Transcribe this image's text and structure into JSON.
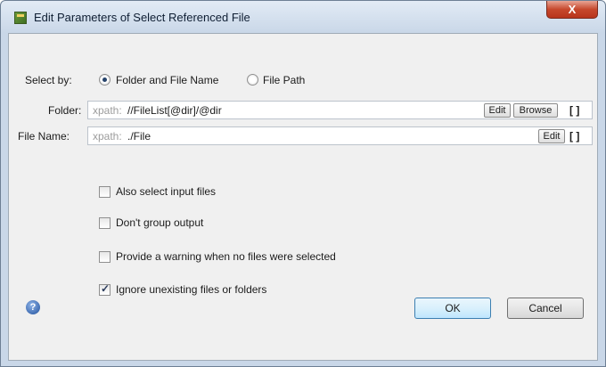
{
  "window": {
    "title": "Edit Parameters of Select Referenced File",
    "close_glyph": "X"
  },
  "select_by": {
    "label": "Select by:",
    "options": [
      {
        "label": "Folder and File Name",
        "selected": true
      },
      {
        "label": "File Path",
        "selected": false
      }
    ]
  },
  "folder": {
    "label": "Folder:",
    "prefix": "xpath:",
    "value": "//FileList[@dir]/@dir",
    "edit_label": "Edit",
    "browse_label": "Browse",
    "brackets": "[ ]"
  },
  "file_name": {
    "label": "File Name:",
    "prefix": "xpath:",
    "value": "./File",
    "edit_label": "Edit",
    "brackets": "[ ]"
  },
  "options": [
    {
      "label": "Also select input files",
      "checked": false
    },
    {
      "label": "Don't group output",
      "checked": false
    },
    {
      "label": "Provide a warning when no files were selected",
      "checked": false
    },
    {
      "label": "Ignore unexisting files or folders",
      "checked": true
    }
  ],
  "footer": {
    "help_glyph": "?",
    "ok_label": "OK",
    "cancel_label": "Cancel"
  }
}
